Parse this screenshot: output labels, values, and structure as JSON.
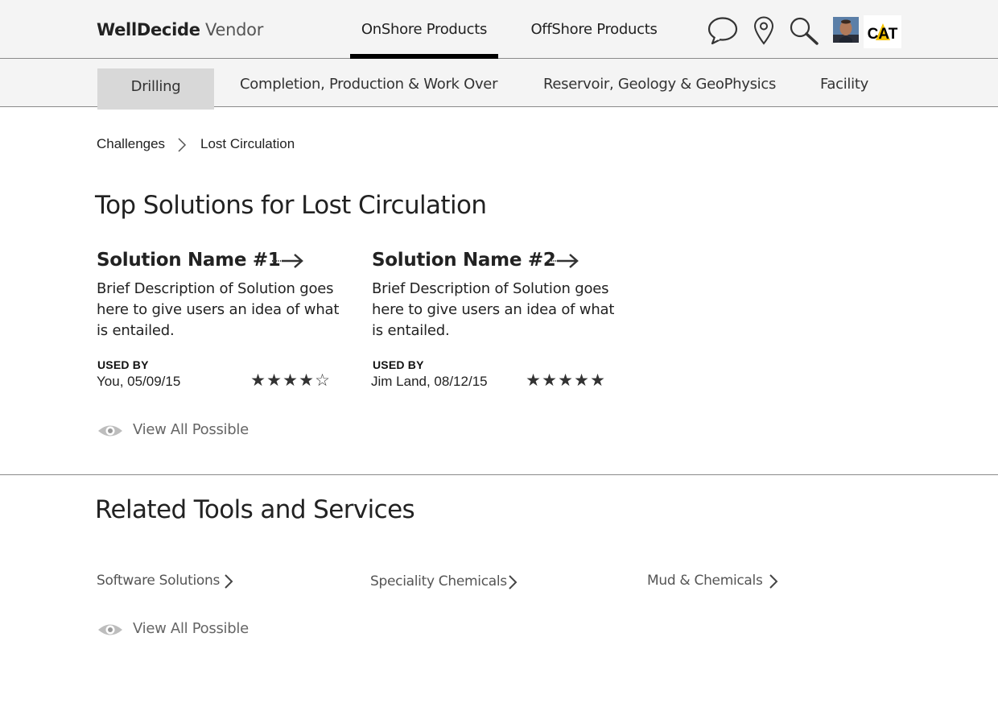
{
  "header": {
    "brand_bold": "WellDecide",
    "brand_light": "Vendor",
    "tabs": [
      {
        "label": "OnShore Products",
        "active": true
      },
      {
        "label": "OffShore Products",
        "active": false
      }
    ],
    "icons": [
      "chat-icon",
      "location-pin-icon",
      "search-icon"
    ],
    "logo_text": "CAT",
    "logo_accent_color": "#f5c400"
  },
  "subnav": {
    "items": [
      {
        "label": "Drilling",
        "active": true
      },
      {
        "label": "Completion, Production & Work Over",
        "active": false
      },
      {
        "label": "Reservoir, Geology & GeoPhysics",
        "active": false
      },
      {
        "label": "Facility",
        "active": false
      }
    ]
  },
  "breadcrumb": {
    "items": [
      "Challenges",
      "Lost Circulation"
    ]
  },
  "solutions": {
    "title": "Top Solutions for Lost Circulation",
    "cards": [
      {
        "name": "Solution Name #1",
        "description": "Brief Description of Solution goes here to give users an idea of what is entailed.",
        "used_by_label": "USED BY",
        "used_by": "You, 05/09/15",
        "rating": 4,
        "rating_max": 5
      },
      {
        "name": "Solution Name #2",
        "description": "Brief Description of Solution goes here to give users an idea of what is entailed.",
        "used_by_label": "USED BY",
        "used_by": "Jim Land, 08/12/15",
        "rating": 5,
        "rating_max": 5
      }
    ],
    "view_all": "View All Possible"
  },
  "related": {
    "title": "Related Tools and Services",
    "links": [
      "Software Solutions",
      "Speciality Chemicals",
      "Mud & Chemicals"
    ],
    "view_all": "View All Possible"
  },
  "colors": {
    "header_bg": "#f4f4f4",
    "active_subtab_bg": "#d8d8d8",
    "active_tab_underline": "#000000",
    "muted_text": "#666666"
  }
}
